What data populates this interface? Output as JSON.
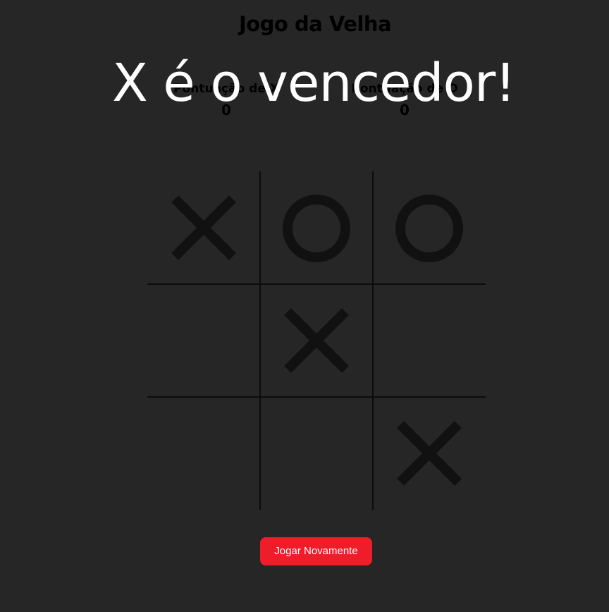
{
  "header": {
    "title": "Jogo da Velha"
  },
  "winner_message": "X é o vencedor!",
  "scores": [
    {
      "label": "Pontuação de X",
      "value": "0"
    },
    {
      "label": "Pontuação de O",
      "value": "0"
    }
  ],
  "board": {
    "cells": [
      "X",
      "O",
      "O",
      "",
      "X",
      "",
      "",
      "",
      "X"
    ]
  },
  "restart_button": {
    "label": "Jogar Novamente"
  },
  "colors": {
    "background": "#262626",
    "mark": "#111111",
    "grid_line": "#0c0c0c",
    "winner_text": "#ffffff",
    "button": "#ef1d2a",
    "button_text": "#ffffff"
  }
}
